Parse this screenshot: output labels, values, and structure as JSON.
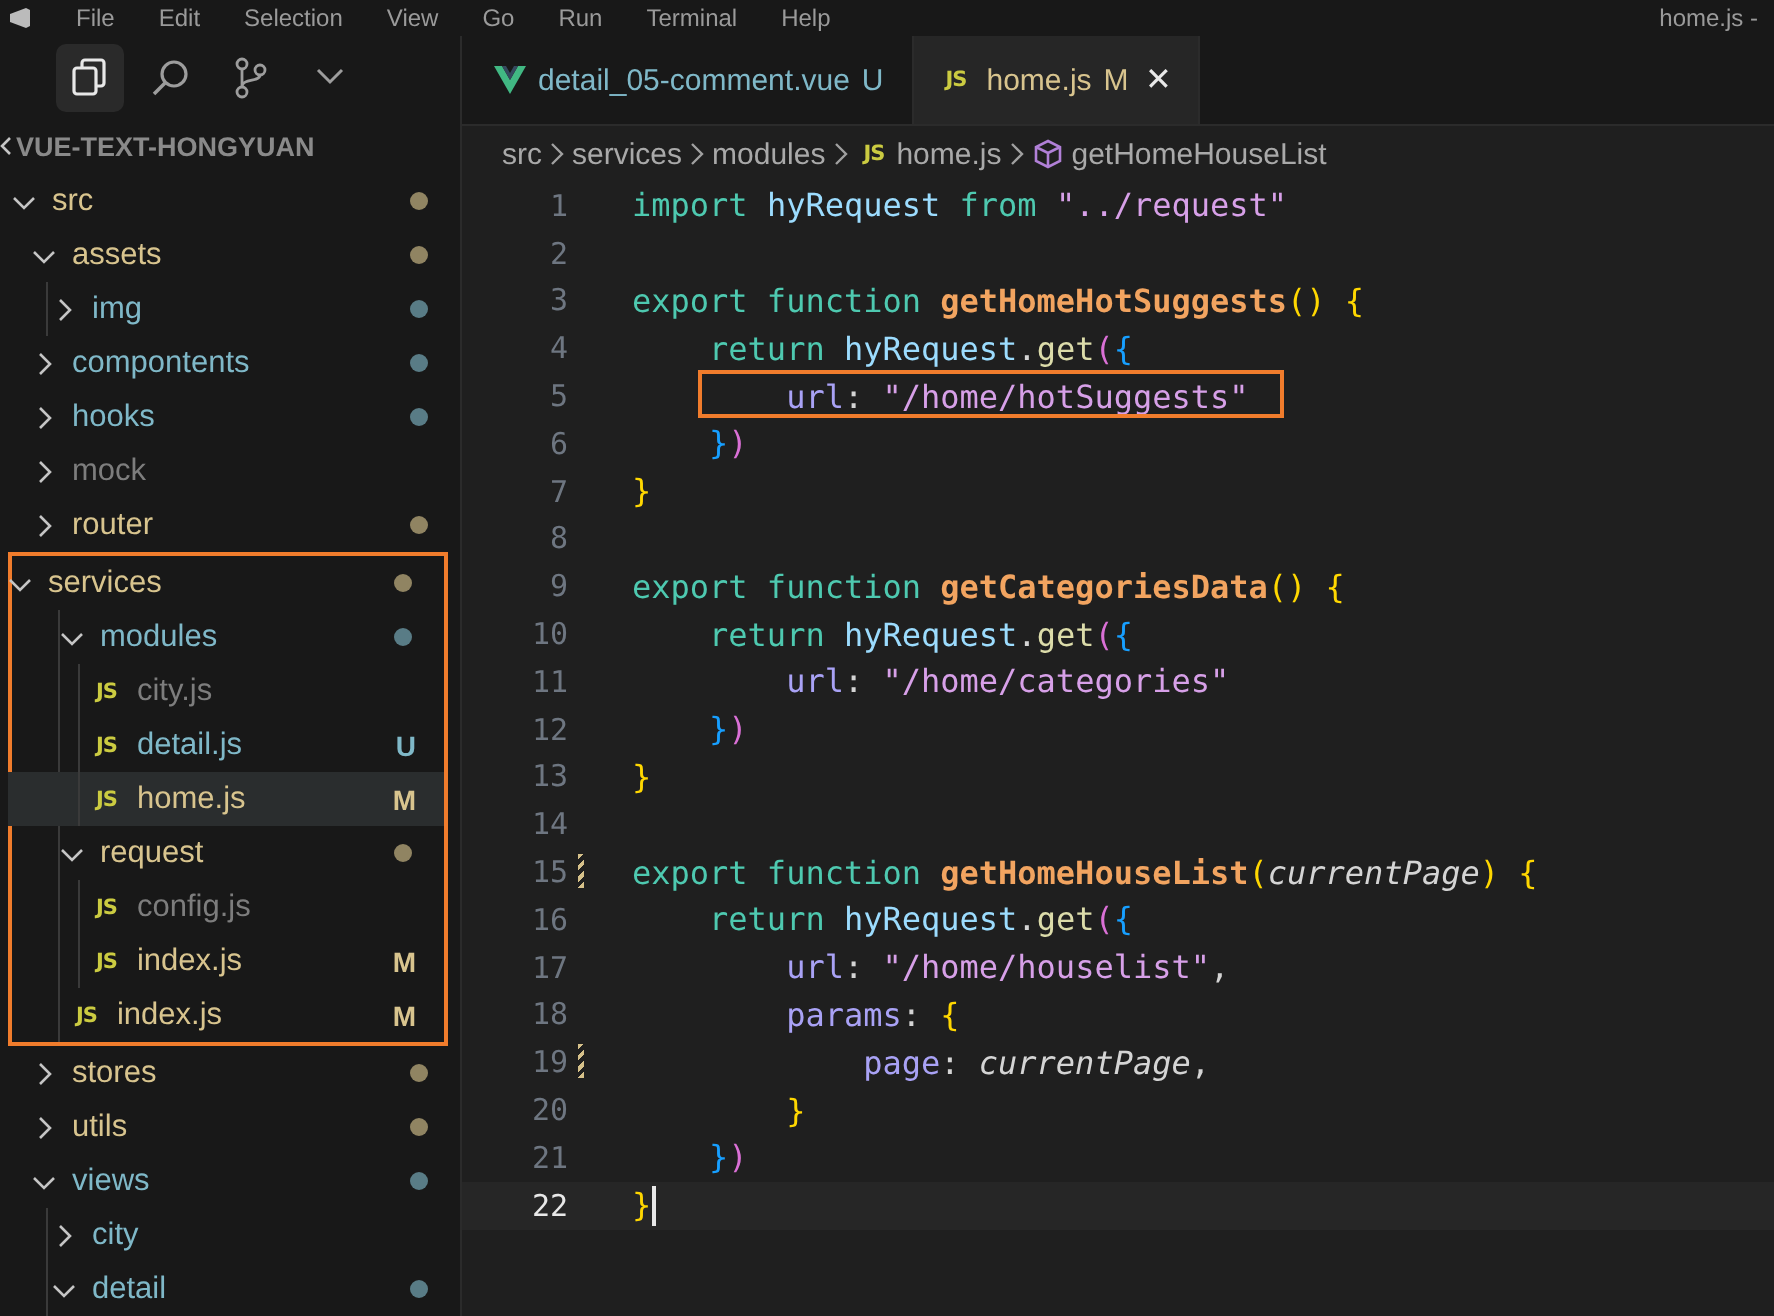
{
  "menu_bar": {
    "items": [
      "File",
      "Edit",
      "Selection",
      "View",
      "Go",
      "Run",
      "Terminal",
      "Help"
    ],
    "title": "home.js -"
  },
  "activity_bar": [
    {
      "selected": true
    },
    {
      "selected": false
    },
    {
      "selected": false
    },
    {
      "selected": false
    }
  ],
  "explorer": {
    "title": "VUE-TEXT-HONGYUAN",
    "tree": [
      {
        "name": "src",
        "kind": "folder",
        "expanded": true,
        "color": "#d8c48e",
        "dot": true,
        "selected": false,
        "boxed": false,
        "children": [
          {
            "name": "assets",
            "kind": "folder",
            "expanded": true,
            "color": "#d8c48e",
            "dot": true,
            "selected": false,
            "boxed": false,
            "children": [
              {
                "name": "img",
                "kind": "folder",
                "expanded": false,
                "color": "#7fb8c8",
                "dot": true,
                "selected": false,
                "boxed": false
              }
            ]
          },
          {
            "name": "compontents",
            "kind": "folder",
            "expanded": false,
            "color": "#7fb8c8",
            "dot": true,
            "selected": false,
            "boxed": false
          },
          {
            "name": "hooks",
            "kind": "folder",
            "expanded": false,
            "color": "#7fb8c8",
            "dot": true,
            "selected": false,
            "boxed": false
          },
          {
            "name": "mock",
            "kind": "folder",
            "expanded": false,
            "color": "#7d7d7d",
            "dot": false,
            "selected": false,
            "boxed": false
          },
          {
            "name": "router",
            "kind": "folder",
            "expanded": false,
            "color": "#d8c48e",
            "dot": true,
            "selected": false,
            "boxed": false
          },
          {
            "name": "services",
            "kind": "folder",
            "expanded": true,
            "color": "#d8c48e",
            "dot": true,
            "selected": false,
            "boxed": true,
            "children": [
              {
                "name": "modules",
                "kind": "folder",
                "expanded": true,
                "color": "#7fb8c8",
                "dot": true,
                "selected": false,
                "boxed": false,
                "children": [
                  {
                    "name": "city.js",
                    "kind": "file",
                    "icon": "JS",
                    "color": "#7d7d7d",
                    "selected": false,
                    "boxed": false
                  },
                  {
                    "name": "detail.js",
                    "kind": "file",
                    "icon": "JS",
                    "color": "#7fb8c8",
                    "badge": "U",
                    "selected": false,
                    "boxed": false
                  },
                  {
                    "name": "home.js",
                    "kind": "file",
                    "icon": "JS",
                    "color": "#d8c48e",
                    "badge": "M",
                    "selected": true,
                    "boxed": false
                  }
                ]
              },
              {
                "name": "request",
                "kind": "folder",
                "expanded": true,
                "color": "#d8c48e",
                "dot": true,
                "selected": false,
                "boxed": false,
                "children": [
                  {
                    "name": "config.js",
                    "kind": "file",
                    "icon": "JS",
                    "color": "#7d7d7d",
                    "selected": false,
                    "boxed": false
                  },
                  {
                    "name": "index.js",
                    "kind": "file",
                    "icon": "JS",
                    "color": "#d8c48e",
                    "badge": "M",
                    "selected": false,
                    "boxed": false
                  }
                ]
              },
              {
                "name": "index.js",
                "kind": "file",
                "icon": "JS",
                "color": "#d8c48e",
                "badge": "M",
                "selected": false,
                "boxed": false
              }
            ]
          },
          {
            "name": "stores",
            "kind": "folder",
            "expanded": false,
            "color": "#d8c48e",
            "dot": true,
            "selected": false,
            "boxed": false
          },
          {
            "name": "utils",
            "kind": "folder",
            "expanded": false,
            "color": "#d8c48e",
            "dot": true,
            "selected": false,
            "boxed": false
          },
          {
            "name": "views",
            "kind": "folder",
            "expanded": true,
            "color": "#7fb8c8",
            "dot": true,
            "selected": false,
            "boxed": false,
            "children": [
              {
                "name": "city",
                "kind": "folder",
                "expanded": false,
                "color": "#7fb8c8",
                "dot": false,
                "selected": false,
                "boxed": false
              },
              {
                "name": "detail",
                "kind": "folder",
                "expanded": true,
                "color": "#7fb8c8",
                "dot": true,
                "selected": false,
                "boxed": false
              }
            ]
          }
        ]
      }
    ]
  },
  "tabs": [
    {
      "kind": "vue",
      "label": "detail_05-comment.vue",
      "status": "U",
      "color": "#7fb8c8",
      "selected": false
    },
    {
      "kind": "js",
      "icon": "JS",
      "label": "home.js",
      "status": "M",
      "color": "#d8c48e",
      "selected": true,
      "close": "✕"
    }
  ],
  "breadcrumb": [
    {
      "kind": "folder",
      "label": "src"
    },
    {
      "kind": "folder",
      "label": "services"
    },
    {
      "kind": "folder",
      "label": "modules"
    },
    {
      "kind": "file",
      "icon": "JS",
      "label": "home.js"
    },
    {
      "kind": "symbol",
      "label": "getHomeHouseList"
    }
  ],
  "code": [
    {
      "number": "1",
      "tokens": [
        {
          "kind": "kw",
          "text": "import "
        },
        {
          "kind": "var",
          "text": "hyRequest "
        },
        {
          "kind": "kw",
          "text": "from "
        },
        {
          "kind": "str",
          "text": "\"../request\""
        }
      ]
    },
    {
      "number": "2"
    },
    {
      "number": "3",
      "tokens": [
        {
          "kind": "kw",
          "text": "export function "
        },
        {
          "kind": "fn",
          "text": "getHomeHotSuggests"
        },
        {
          "kind": "b1",
          "text": "() {"
        }
      ]
    },
    {
      "number": "4",
      "tokens": [
        {
          "kind": "kw",
          "text": "    return "
        },
        {
          "kind": "var",
          "text": "hyRequest"
        },
        {
          "kind": "plain",
          "text": "."
        },
        {
          "kind": "call",
          "text": "get"
        },
        {
          "kind": "b2",
          "text": "("
        },
        {
          "kind": "b3",
          "text": "{"
        }
      ]
    },
    {
      "number": "5",
      "boxed": true,
      "tokens": [
        {
          "kind": "prop",
          "text": "        url"
        },
        {
          "kind": "plain",
          "text": ": "
        },
        {
          "kind": "str",
          "text": "\"/home/hotSuggests\""
        }
      ]
    },
    {
      "number": "6",
      "tokens": [
        {
          "kind": "b3",
          "text": "    }"
        },
        {
          "kind": "b2",
          "text": ")"
        }
      ]
    },
    {
      "number": "7",
      "tokens": [
        {
          "kind": "b1",
          "text": "}"
        }
      ]
    },
    {
      "number": "8"
    },
    {
      "number": "9",
      "tokens": [
        {
          "kind": "kw",
          "text": "export function "
        },
        {
          "kind": "fn",
          "text": "getCategoriesData"
        },
        {
          "kind": "b1",
          "text": "() {"
        }
      ]
    },
    {
      "number": "10",
      "tokens": [
        {
          "kind": "kw",
          "text": "    return "
        },
        {
          "kind": "var",
          "text": "hyRequest"
        },
        {
          "kind": "plain",
          "text": "."
        },
        {
          "kind": "call",
          "text": "get"
        },
        {
          "kind": "b2",
          "text": "("
        },
        {
          "kind": "b3",
          "text": "{"
        }
      ]
    },
    {
      "number": "11",
      "tokens": [
        {
          "kind": "prop",
          "text": "        url"
        },
        {
          "kind": "plain",
          "text": ": "
        },
        {
          "kind": "str",
          "text": "\"/home/categories\""
        }
      ]
    },
    {
      "number": "12",
      "tokens": [
        {
          "kind": "b3",
          "text": "    }"
        },
        {
          "kind": "b2",
          "text": ")"
        }
      ]
    },
    {
      "number": "13",
      "tokens": [
        {
          "kind": "b1",
          "text": "}"
        }
      ]
    },
    {
      "number": "14"
    },
    {
      "number": "15",
      "changed": true,
      "tokens": [
        {
          "kind": "kw",
          "text": "export function "
        },
        {
          "kind": "fn",
          "text": "getHomeHouseList"
        },
        {
          "kind": "b1",
          "text": "("
        },
        {
          "kind": "param",
          "text": "currentPage"
        },
        {
          "kind": "b1",
          "text": ") {"
        }
      ]
    },
    {
      "number": "16",
      "tokens": [
        {
          "kind": "kw",
          "text": "    return "
        },
        {
          "kind": "var",
          "text": "hyRequest"
        },
        {
          "kind": "plain",
          "text": "."
        },
        {
          "kind": "call",
          "text": "get"
        },
        {
          "kind": "b2",
          "text": "("
        },
        {
          "kind": "b3",
          "text": "{"
        }
      ]
    },
    {
      "number": "17",
      "tokens": [
        {
          "kind": "prop",
          "text": "        url"
        },
        {
          "kind": "plain",
          "text": ": "
        },
        {
          "kind": "str",
          "text": "\"/home/houselist\""
        },
        {
          "kind": "plain",
          "text": ","
        }
      ]
    },
    {
      "number": "18",
      "tokens": [
        {
          "kind": "prop",
          "text": "        params"
        },
        {
          "kind": "plain",
          "text": ": "
        },
        {
          "kind": "b1",
          "text": "{"
        }
      ]
    },
    {
      "number": "19",
      "changed": true,
      "tokens": [
        {
          "kind": "prop",
          "text": "            page"
        },
        {
          "kind": "plain",
          "text": ": "
        },
        {
          "kind": "param",
          "text": "currentPage"
        },
        {
          "kind": "plain",
          "text": ","
        }
      ]
    },
    {
      "number": "20",
      "tokens": [
        {
          "kind": "b1",
          "text": "        }"
        }
      ]
    },
    {
      "number": "21",
      "tokens": [
        {
          "kind": "b3",
          "text": "    }"
        },
        {
          "kind": "b2",
          "text": ")"
        }
      ]
    },
    {
      "number": "22",
      "current": true,
      "tokens": [
        {
          "kind": "b1",
          "text": "}"
        }
      ]
    }
  ]
}
